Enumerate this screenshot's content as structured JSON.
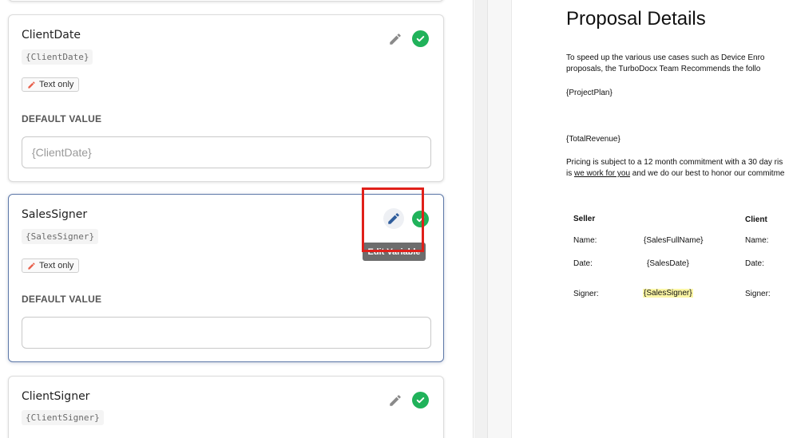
{
  "cards": [
    {
      "title": "ClientDate",
      "token": "{ClientDate}",
      "tag": "Text only",
      "default_label": "DEFAULT VALUE",
      "default_value": "",
      "default_placeholder": "{ClientDate}"
    },
    {
      "title": "SalesSigner",
      "token": "{SalesSigner}",
      "tag": "Text only",
      "default_label": "DEFAULT VALUE",
      "default_value": "",
      "default_placeholder": ""
    },
    {
      "title": "ClientSigner",
      "token": "{ClientSigner}"
    }
  ],
  "tooltip": "Edit Variable",
  "icons": {
    "edit": "pencil-icon",
    "confirm": "check-circle-icon",
    "tag": "pencil-icon"
  },
  "colors": {
    "check": "#20b25a",
    "active_border": "#5d78a8",
    "highlight": "#e0201a",
    "edit_active": "#2f5d9c",
    "signer_highlight": "#fbf6a6"
  },
  "document": {
    "title": "Proposal Details",
    "intro_line1": "To speed up the various use cases such as Device Enro",
    "intro_line2": "proposals, the TurboDocx Team Recommends the follo",
    "project_plan": "{ProjectPlan}",
    "total_revenue": "{TotalRevenue}",
    "pricing_line1": "Pricing is subject to a 12 month commitment with a 30 day ris",
    "pricing_line2_a": "is ",
    "pricing_line2_link": "we work for you",
    "pricing_line2_b": " and we do our best to honor our commitme",
    "seller_header": "Seller",
    "client_header": "Client",
    "rows": [
      {
        "label": "Name:",
        "value": "{SalesFullName}",
        "client_label": "Name:"
      },
      {
        "label": "Date:",
        "value": "{SalesDate}",
        "client_label": "Date:"
      },
      {
        "label": "Signer:",
        "value": "{SalesSigner}",
        "client_label": "Signer:"
      }
    ]
  }
}
